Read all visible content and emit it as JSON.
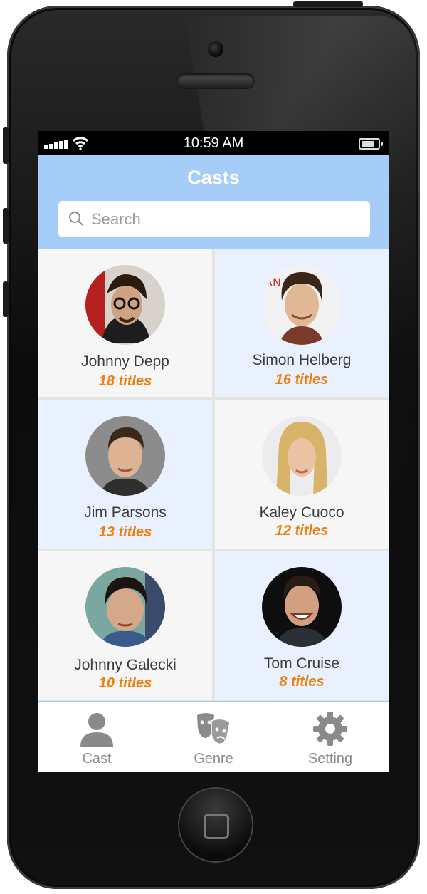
{
  "status": {
    "time": "10:59 AM"
  },
  "header": {
    "title": "Casts"
  },
  "search": {
    "placeholder": "Search"
  },
  "cast": [
    {
      "name": "Johnny Depp",
      "titles": "18 titles"
    },
    {
      "name": "Simon Helberg",
      "titles": "16 titles"
    },
    {
      "name": "Jim Parsons",
      "titles": "13 titles"
    },
    {
      "name": "Kaley Cuoco",
      "titles": "12 titles"
    },
    {
      "name": "Johnny Galecki",
      "titles": "10 titles"
    },
    {
      "name": "Tom Cruise",
      "titles": "8 titles"
    }
  ],
  "tabs": [
    {
      "label": "Cast",
      "icon": "person-icon"
    },
    {
      "label": "Genre",
      "icon": "theater-masks-icon"
    },
    {
      "label": "Setting",
      "icon": "gear-icon"
    }
  ],
  "colors": {
    "header": "#a5cdf8",
    "accent": "#f07d0d",
    "tab_inactive": "#8a8a8a"
  }
}
